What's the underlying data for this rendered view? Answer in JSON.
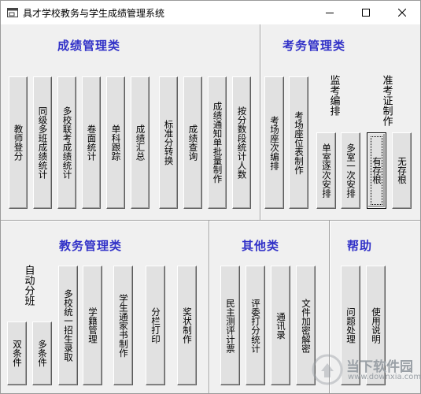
{
  "window": {
    "title": "具才学校教务与学生成绩管理系统"
  },
  "sections": {
    "grades": {
      "title": "成绩管理类",
      "buttons": [
        "教师登分",
        "同级多班成绩统计",
        "多校联考成绩统计",
        "卷面统计",
        "单科跟踪",
        "成绩汇总",
        "标准分转换",
        "成绩查询",
        "成绩通知单批量制作",
        "按分数段统计人数"
      ]
    },
    "exam": {
      "title": "考务管理类",
      "buttons": [
        "考场座次编排",
        "考场座位表制作",
        "单室逐次安排",
        "多室一次安排",
        "有存根",
        "无存根"
      ],
      "group_labels": {
        "proctor": "监考编排",
        "ticket": "准考证制作"
      }
    },
    "academic": {
      "title": "教务管理类",
      "group_label": "自动分班",
      "buttons": [
        "双条件",
        "多条件",
        "多校统一招生录取",
        "学籍管理",
        "学生通家书制作",
        "分栏打印",
        "奖状制作"
      ]
    },
    "other": {
      "title": "其他类",
      "buttons": [
        "民主测评计票",
        "评委打分统计",
        "通讯录",
        "文件加密解密"
      ]
    },
    "help": {
      "title": "帮助",
      "buttons": [
        "问题处理",
        "使用说明"
      ]
    }
  },
  "watermark": {
    "text": "当下软件园",
    "url": "www.downxia.com"
  },
  "colors": {
    "section_title": "#3232c8",
    "face": "#f0f0f0",
    "button": "#e1e1e1"
  }
}
